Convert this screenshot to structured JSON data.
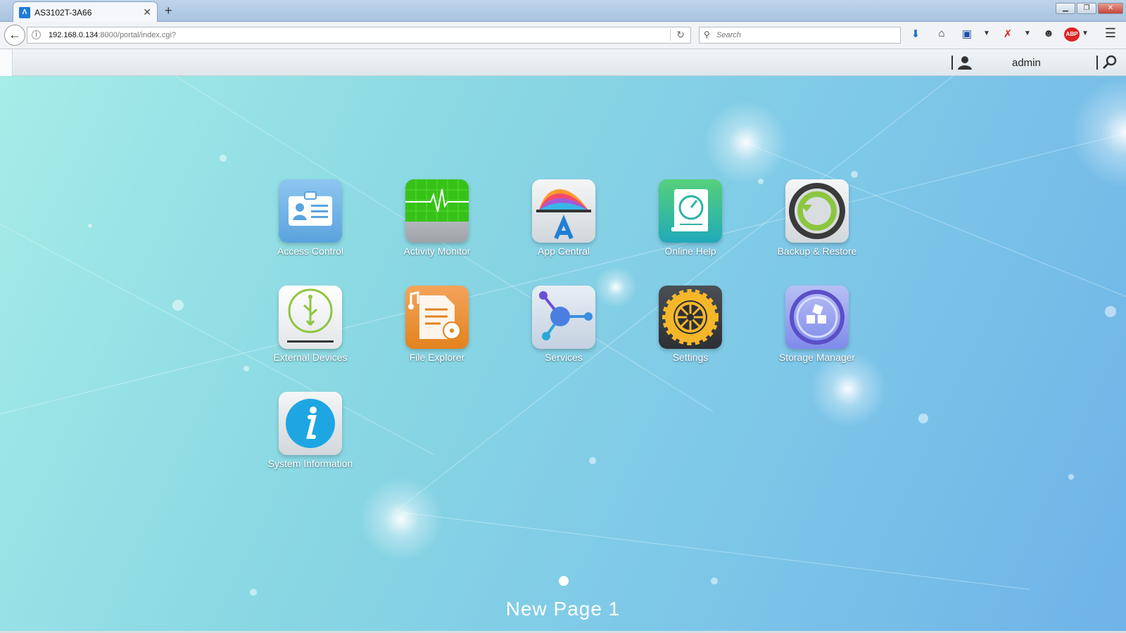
{
  "browser": {
    "tab_title": "AS3102T-3A66",
    "tab_favicon": "asustor-favicon",
    "new_tab_label": "+",
    "url_host": "192.168.0.134",
    "url_path": ":8000/portal/index.cgi?",
    "search_placeholder": "Search",
    "window_buttons": [
      "minimize-icon",
      "restore-icon",
      "close-icon"
    ]
  },
  "toolbar_icons": [
    "download-icon",
    "home-icon",
    "save-icon",
    "dropdown-icon",
    "addon-icon",
    "dropdown-icon",
    "ghost-icon",
    "adblock-plus-icon",
    "menu-icon"
  ],
  "adblock_label": "ABP",
  "header": {
    "username": "admin"
  },
  "apps": [
    {
      "label": "Access Control",
      "icon": "access-control-icon",
      "color": "#6eb2e6"
    },
    {
      "label": "Activity Monitor",
      "icon": "activity-monitor-icon",
      "color": "#39c41a"
    },
    {
      "label": "App Central",
      "icon": "app-central-icon",
      "color": "#e8ecef"
    },
    {
      "label": "Online Help",
      "icon": "online-help-icon",
      "color": "#2cb6a0"
    },
    {
      "label": "Backup & Restore",
      "icon": "backup-restore-icon",
      "color": "#e7eaec"
    },
    {
      "label": "External Devices",
      "icon": "external-devices-icon",
      "color": "#f2f4f3"
    },
    {
      "label": "File Explorer",
      "icon": "file-explorer-icon",
      "color": "#ee9a3a"
    },
    {
      "label": "Services",
      "icon": "services-icon",
      "color": "#d8e3ef"
    },
    {
      "label": "Settings",
      "icon": "settings-icon",
      "color": "#3b3f44"
    },
    {
      "label": "Storage Manager",
      "icon": "storage-manager-icon",
      "color": "#8a95ef"
    },
    {
      "label": "System Information",
      "icon": "system-information-icon",
      "color": "#1ea6e2"
    }
  ],
  "page": {
    "name": "New Page 1"
  }
}
